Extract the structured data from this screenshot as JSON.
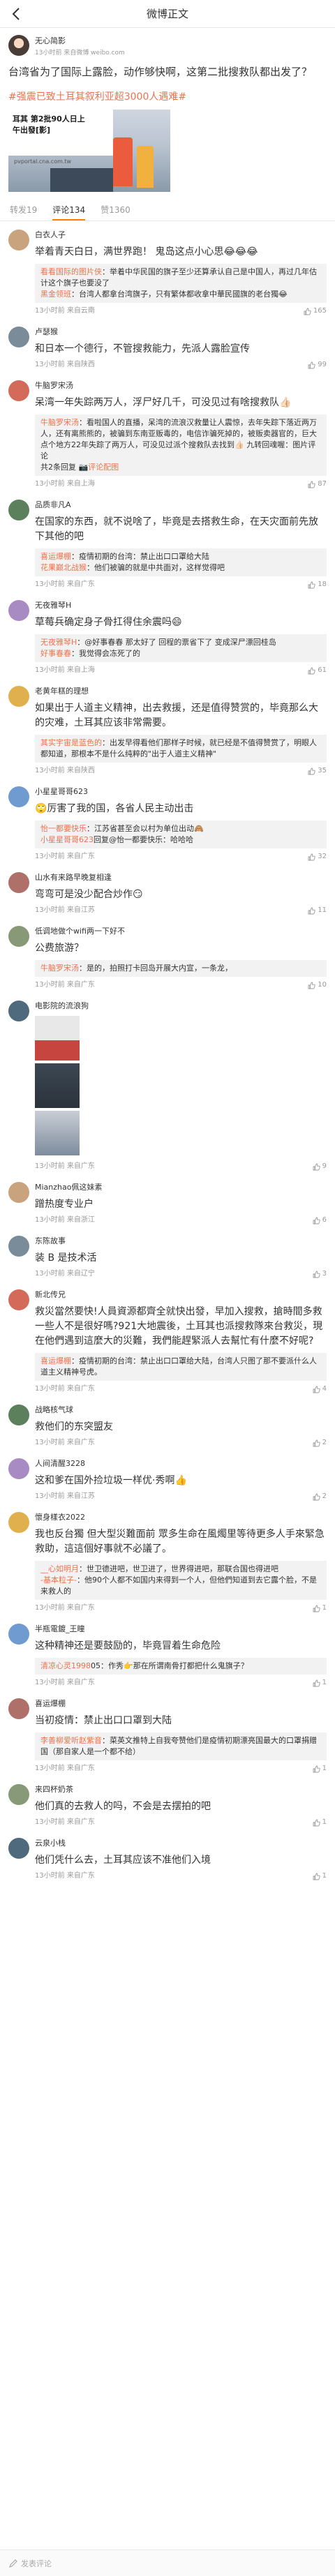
{
  "header": {
    "title": "微博正文"
  },
  "post": {
    "author": "无心简影",
    "time": "13小时前 来自微博 weibo.com",
    "text": "台湾省为了国际上露脸，动作够快啊，这第二批搜救队都出发了？",
    "tag": "#强震已致土耳其叙利亚超3000人遇难#",
    "image": {
      "line1": "耳其 第2批90人日上",
      "line2": "午出發[影]",
      "site": "pvportal.cna.com.tw"
    }
  },
  "tabs": [
    {
      "label": "转发19"
    },
    {
      "label": "评论134"
    },
    {
      "label": "赞1360"
    }
  ],
  "comments": [
    {
      "name": "白衣人子",
      "text": "举着青天白日，满世界跑！ 鬼岛这点小心思😂😂😂",
      "replies": [
        {
          "name": "看看国际的图片侠",
          "text": "：举着中华民国的旗子至少还算承认自己是中国人，再过几年估计这个旗子也要没了"
        },
        {
          "name": "黑金领班",
          "text": "：台湾人都拿台湾旗子，只有繁体都收拿中華民國旗的老台獨😂"
        }
      ],
      "time": "13小时前 来自云南",
      "likes": "165"
    },
    {
      "name": "卢瑟猴",
      "text": "和日本一个德行，不管搜救能力，先派人露脸宣传",
      "time": "13小时前 来自陕西",
      "likes": "99"
    },
    {
      "name": "牛脑罗宋汤",
      "text": "呆湾一年失踪两万人，浮尸好几千，可没见过有啥搜救队👍🏻",
      "replies": [
        {
          "name": "牛脑罗宋汤",
          "text": "：看啦国人的直播，呆湾的流浪汉救量让人震惊，去年失踪下落近两万人，还有离熊熊的，被骗到东南亚贩毒的，电信诈骗死掉的，被贩卖器官的，巨大点个地方22年失踪了两万人，可没见过派个搜救队去找到👍🏻 九转回魂喔：图片评论"
        },
        {
          "name": "",
          "text": "共2条回复 ",
          "more": "📷评论配图"
        }
      ],
      "time": "13小时前 来自上海",
      "likes": "87"
    },
    {
      "name": "品质非凡A",
      "text": "在国家的东西，就不说啥了，毕竟是去搭救生命，在天灾面前先放下其他的吧",
      "replies": [
        {
          "name": "喜运爆棚",
          "text": "：疫情初期的台湾：禁止出口口罩给大陆"
        },
        {
          "name": "花果巅北战猴",
          "text": "：他们被骗的就是中共面对，这样觉得吧"
        }
      ],
      "time": "13小时前 来自广东",
      "likes": "18"
    },
    {
      "name": "无夜雅琴H",
      "text": "草莓兵确定身子骨扛得住余震吗😄",
      "replies": [
        {
          "name": "无夜雅琴H",
          "text": "：@好事春春 那太好了 回程的票省下了 变成深尸漂回桂岛"
        },
        {
          "name": "好事春春",
          "text": "：我觉得会冻死了的"
        }
      ],
      "time": "13小时前 来自上海",
      "likes": "61"
    },
    {
      "name": "老黄年糕的理想",
      "text": "如果出于人道主义精神，出去救援，还是值得赞赏的，毕竟那么大的灾难，土耳其应该非常需要。",
      "replies": [
        {
          "name": "其实宇宙是蓝色的",
          "text": "：出发早得看他们那样子时候，就已经是不值得赞赏了，明眼人都知道，那根本不是什么纯粹的\"出于人道主义精神\""
        }
      ],
      "time": "13小时前 来自陕西",
      "likes": "35"
    },
    {
      "name": "小星星哥哥623",
      "text": "🙄厉害了我的国，各省人民主动出击",
      "replies": [
        {
          "name": "怡一都要快乐",
          "text": "：江苏省甚至会以村为单位出动🙈"
        },
        {
          "name": "小星星哥哥623",
          "text": "回复@怡一都要快乐：哈哈哈"
        }
      ],
      "time": "13小时前 来自广东",
      "likes": "32"
    },
    {
      "name": "山水有来路早晚复相逢",
      "text": "弯弯可是没少配合炒作😏",
      "time": "13小时前 来自江苏",
      "likes": "11"
    },
    {
      "name": "低调地做个wifi两一下好不",
      "text": "公费旅游？",
      "replies": [
        {
          "name": "牛脑罗宋汤",
          "text": "：是的，拍照打卡回岛开展大内宣，一条龙，"
        }
      ],
      "time": "13小时前 来自广东",
      "likes": "10"
    },
    {
      "name": "电影院的流浪狗",
      "text": "",
      "pics": true,
      "time": "13小时前 来自广东",
      "likes": "9"
    },
    {
      "name": "Mianzhao佩这妹素",
      "text": "蹭热度专业户",
      "time": "13小时前 来自浙江",
      "likes": "6"
    },
    {
      "name": "东陈故事",
      "text": "装 B 是技术活",
      "time": "13小时前 来自辽宁",
      "likes": "3"
    },
    {
      "name": "新北传兄",
      "text": "救災當然要快!人員資源都齊全就快出發，早加入搜救，搶時間多救一些人不是很好嗎?921大地震後，土耳其也派搜救隊來台救災，現在他們遇到這麼大的災難，我們能趕緊派人去幫忙有什麼不好呢?",
      "replies": [
        {
          "name": "喜运爆棚",
          "text": "：疫情初期的台湾：禁止出口口罩给大陆，台湾人只图了那不要派什么人道主义精神号虎。"
        }
      ],
      "time": "13小时前 来自广东",
      "likes": "4"
    },
    {
      "name": "战略核气球",
      "text": "救他们的东突盟友",
      "time": "13小时前 来自广东",
      "likes": "2"
    },
    {
      "name": "人间清醒3228",
      "text": "这和爹在国外捡垃圾一样优·秀啊👍",
      "time": "13小时前 来自江苏",
      "likes": "2"
    },
    {
      "name": "懷身樣衣2022",
      "text": "我也反台獨 但大型災難面前 眾多生命在風燭里等待更多人手來緊急救助，這這個好事就不必議了。",
      "replies": [
        {
          "name": "__心如明月",
          "text": "：世卫德进吧，世卫进了，世界得进吧，那联合国也得进吧"
        },
        {
          "name": "-基本粒子-",
          "text": "：他90个人都不如国内来得到一个人，但他們知道到去它露个脸，不是来救人的"
        }
      ],
      "time": "13小时前 来自广东",
      "likes": "1"
    },
    {
      "name": "半瓶電鍍_王瞳",
      "text": "这种精神还是要鼓励的，毕竟冒着生命危险",
      "replies": [
        {
          "name": "清凉心灵1998",
          "text": "05：作秀👉那在所谓南骨打都把什么鬼旗子？"
        }
      ],
      "time": "13小时前 来自广东",
      "likes": "1"
    },
    {
      "name": "喜运爆棚",
      "text": "当初疫情：禁止出口口罩到大陆",
      "replies": [
        {
          "name": "李善柳爱听赵紫音",
          "text": "：菜英文推特上自我夸赞他们是疫情初期漂亮国最大的口罩捐赠国（那自家人是一个都不给）"
        }
      ],
      "time": "13小时前 来自广东",
      "likes": "1"
    },
    {
      "name": "来四杯奶茶",
      "text": "他们真的去救人的吗，不会是去摆拍的吧",
      "time": "13小时前 来自广东",
      "likes": "1"
    },
    {
      "name": "云泉小栈",
      "text": "他们凭什么去，土耳其应该不准他们入境",
      "time": "13小时前 来自广东",
      "likes": "1"
    }
  ],
  "bottom": {
    "placeholder": "发表评论"
  },
  "colors": {
    "accent": "#ff8200",
    "link": "#eb7350",
    "tag": "#eb7350"
  }
}
